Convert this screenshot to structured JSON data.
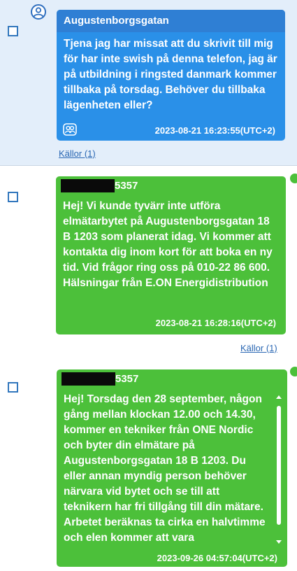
{
  "messages": [
    {
      "sender": "Augustenborgsgatan",
      "text": "Tjena jag har missat att du skrivit till mig för har inte swish på denna telefon, jag är på utbildning i ringsted danmark kommer tillbaka på torsdag. Behöver du tillbaka lägenheten eller?",
      "timestamp": "2023-08-21 16:23:55(UTC+2)",
      "sources_link": "Källor (1)",
      "color": "#2a90e8"
    },
    {
      "sender": "5357",
      "text": "Hej! Vi kunde tyvärr inte utföra elmätarbytet på Augustenborgsgatan 18 B 1203 som planerat idag. Vi kommer att kontakta dig inom kort för att boka en ny tid. Vid frågor ring oss på 010-22 86 600. Hälsningar från E.ON Energidistribution",
      "timestamp": "2023-08-21 16:28:16(UTC+2)",
      "sources_link": "Källor (1)",
      "color": "#4cc03a"
    },
    {
      "sender": "5357",
      "text": "Hej! Torsdag den 28 september, någon gång mellan klockan 12.00 och 14.30, kommer en tekniker från ONE Nordic och byter din elmätare på Augustenborgsgatan 18 B 1203. Du eller annan myndig person behöver närvara vid bytet och se till att teknikern har fri tillgång till din mätare. Arbetet beräknas ta cirka en halvtimme och elen kommer att vara",
      "timestamp": "2023-09-26 04:57:04(UTC+2)",
      "color": "#4cc03a"
    }
  ]
}
